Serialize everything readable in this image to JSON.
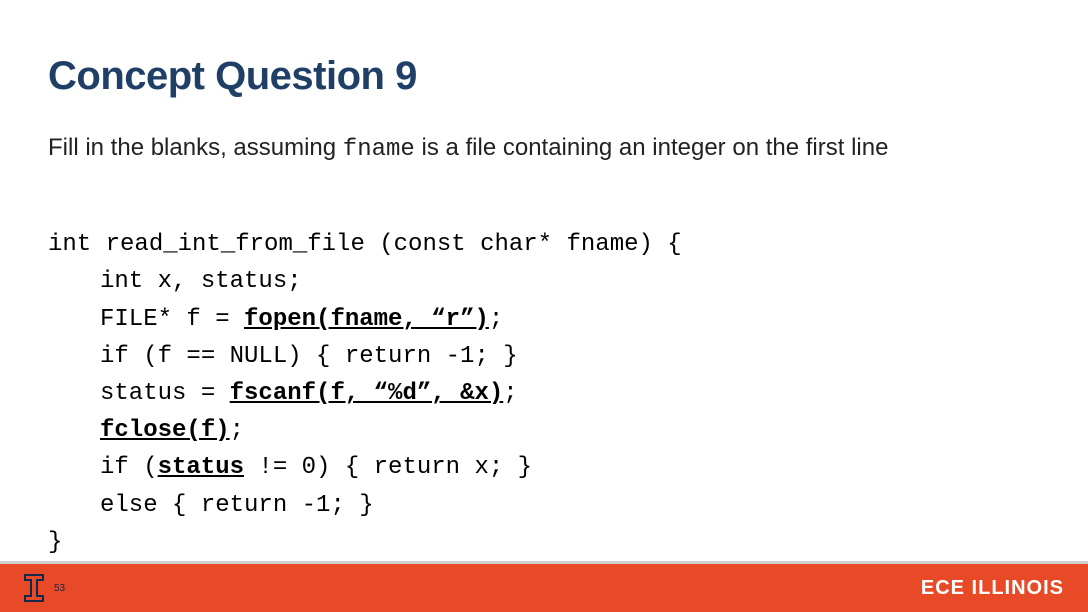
{
  "title": "Concept Question 9",
  "prompt": {
    "before": "Fill in the blanks, assuming ",
    "mono": "fname",
    "after": " is a file containing an integer on the first line"
  },
  "code": {
    "l1": "int read_int_from_file (const char* fname) {",
    "l2a": "int x, status;",
    "l3a": "FILE* f = ",
    "l3u": "fopen(fname, “r”)",
    "l3b": ";",
    "l4a": "if (f == NULL) { return -1; }",
    "l5a": "status = ",
    "l5u": "fscanf(f, “%d”, &x)",
    "l5b": ";",
    "l6u": "fclose(f)",
    "l6b": ";",
    "l7a": "if (",
    "l7u": "status",
    "l7b": " != 0) { return x; }",
    "l8a": "else { return -1; }",
    "l9": "}"
  },
  "footer": {
    "page": "53",
    "eceBold": "ECE",
    "eceRest": " ILLINOIS"
  }
}
